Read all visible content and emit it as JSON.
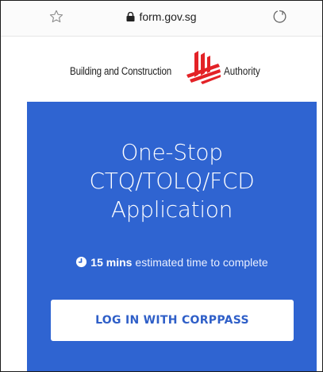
{
  "browser": {
    "url": "form.gov.sg",
    "icons": {
      "bookmark": "star-outline-icon",
      "secure": "lock-icon",
      "reload": "reload-icon"
    }
  },
  "header": {
    "logo_left": "Building and Construction",
    "logo_right": "Authority",
    "logo_color": "#e32227"
  },
  "hero": {
    "background": "#2f64d1",
    "title_lines": [
      "One-Stop",
      "CTQ/TOLQ/FCD",
      "Application"
    ],
    "estimate_value": "15 mins",
    "estimate_text": "estimated time to complete",
    "clock_icon": "clock-icon",
    "login_label": "LOG IN WITH CORPPASS"
  }
}
